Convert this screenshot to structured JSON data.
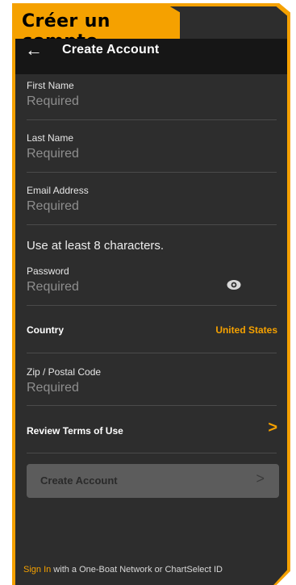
{
  "banner": {
    "text": "Créer un compte"
  },
  "header": {
    "title": "Create Account",
    "back_icon": "arrow-left-icon"
  },
  "fields": {
    "first_name": {
      "label": "First Name",
      "placeholder": "Required"
    },
    "last_name": {
      "label": "Last Name",
      "placeholder": "Required"
    },
    "email": {
      "label": "Email Address",
      "placeholder": "Required"
    },
    "password_hint": "Use at least 8 characters.",
    "password": {
      "label": "Password",
      "placeholder": "Required",
      "icon": "eye-icon"
    },
    "zip": {
      "label": "Zip / Postal Code",
      "placeholder": "Required"
    }
  },
  "country": {
    "label": "Country",
    "value": "United States"
  },
  "terms": {
    "label": "Review Terms of Use",
    "chevron": ">"
  },
  "create_button": {
    "label": "Create Account",
    "arrow": ">"
  },
  "footer": {
    "link": "Sign In",
    "rest": " with a One-Boat Network or ChartSelect ID"
  },
  "colors": {
    "accent": "#f5a100",
    "background": "#2d2d2d",
    "topbar": "#161616"
  }
}
